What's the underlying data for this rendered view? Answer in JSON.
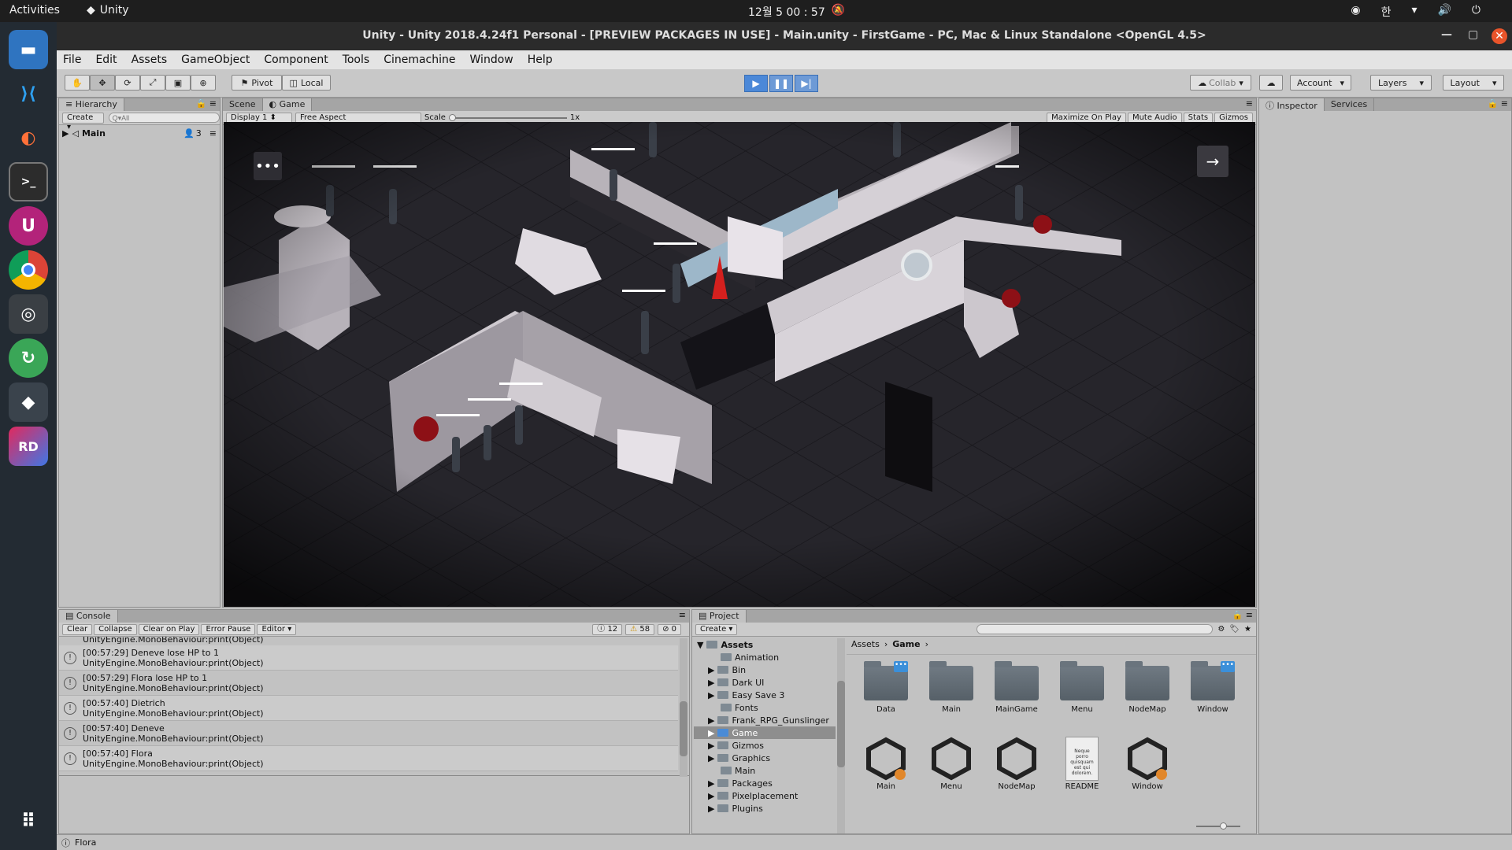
{
  "topbar": {
    "activities": "Activities",
    "app_name": "Unity",
    "clock": "12월 5  00 : 57",
    "ime": "한"
  },
  "window": {
    "title": "Unity - Unity 2018.4.24f1 Personal - [PREVIEW PACKAGES IN USE] - Main.unity - FirstGame - PC, Mac & Linux Standalone <OpenGL 4.5>"
  },
  "menu": [
    "File",
    "Edit",
    "Assets",
    "GameObject",
    "Component",
    "Tools",
    "Cinemachine",
    "Window",
    "Help"
  ],
  "toolbar": {
    "pivot": "Pivot",
    "local": "Local",
    "collab": "Collab",
    "account": "Account",
    "layers": "Layers",
    "layout": "Layout"
  },
  "hierarchy": {
    "tab": "Hierarchy",
    "create": "Create",
    "search_placeholder": "Q▾All",
    "root_item": "Main",
    "root_count": "3"
  },
  "scene_tabs": {
    "scene": "Scene",
    "game": "Game"
  },
  "game_bar": {
    "display": "Display 1",
    "aspect": "Free Aspect",
    "scale_label": "Scale",
    "scale_value": "1x",
    "maximize": "Maximize On Play",
    "mute": "Mute Audio",
    "stats": "Stats",
    "gizmos": "Gizmos"
  },
  "inspector": {
    "tab": "Inspector",
    "services": "Services"
  },
  "console": {
    "tab": "Console",
    "buttons": [
      "Clear",
      "Collapse",
      "Clear on Play",
      "Error Pause",
      "Editor"
    ],
    "counts": {
      "info": "12",
      "warn": "58",
      "error": "0"
    },
    "top_fragment": "UnityEngine.MonoBehaviour:print(Object)",
    "rows": [
      {
        "line1": "[00:57:29] Deneve lose HP to 1",
        "line2": "UnityEngine.MonoBehaviour:print(Object)"
      },
      {
        "line1": "[00:57:29] Flora lose HP to 1",
        "line2": "UnityEngine.MonoBehaviour:print(Object)"
      },
      {
        "line1": "[00:57:40] Dietrich",
        "line2": "UnityEngine.MonoBehaviour:print(Object)"
      },
      {
        "line1": "[00:57:40] Deneve",
        "line2": "UnityEngine.MonoBehaviour:print(Object)"
      },
      {
        "line1": "[00:57:40] Flora",
        "line2": "UnityEngine.MonoBehaviour:print(Object)"
      }
    ]
  },
  "project": {
    "tab": "Project",
    "create": "Create",
    "breadcrumb_root": "Assets",
    "breadcrumb_current": "Game",
    "tree_root": "Assets",
    "tree": [
      "Animation",
      "Bin",
      "Dark UI",
      "Easy Save 3",
      "Fonts",
      "Frank_RPG_Gunslinger",
      "Game",
      "Gizmos",
      "Graphics",
      "Main",
      "Packages",
      "Pixelplacement",
      "Plugins"
    ],
    "folders": [
      "Data",
      "Main",
      "MainGame",
      "Menu",
      "NodeMap",
      "Window"
    ],
    "files": [
      "Main",
      "Menu",
      "NodeMap",
      "README",
      "Window"
    ],
    "readme_preview": "Neque porro quisquam est qui dolorem."
  },
  "status_bar": {
    "text": "Flora"
  },
  "dock": [
    "files-icon",
    "vscode-icon",
    "firefox-icon",
    "terminal-icon",
    "ubuntu-software-icon",
    "chrome-icon",
    "screenshot-icon",
    "update-icon",
    "unity-icon",
    "rider-icon",
    "apps-grid-icon"
  ]
}
